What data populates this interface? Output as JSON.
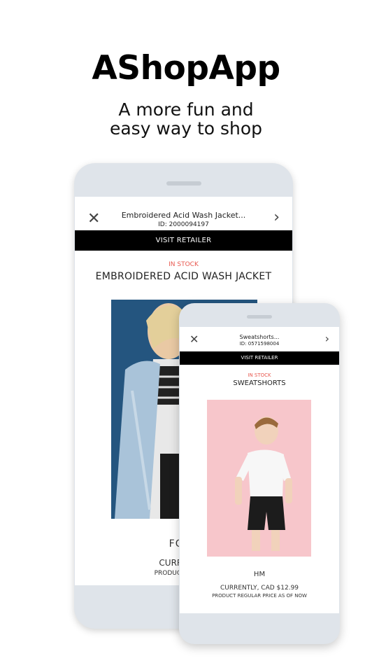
{
  "hero": {
    "title": "AShopApp",
    "subtitle_line1": "A more fun and",
    "subtitle_line2": "easy way to shop"
  },
  "back_screen": {
    "nav": {
      "title": "Embroidered Acid Wash Jacket...",
      "id": "ID: 2000094197",
      "close_icon": "close-icon",
      "next_icon": "chevron-right-icon"
    },
    "visit_label": "VISIT RETAILER",
    "stock": "IN STOCK",
    "product_name": "EMBROIDERED ACID WASH JACKET",
    "brand": "FORE",
    "price": "CURRENTLY",
    "note": "PRODUCT REGULA"
  },
  "front_screen": {
    "nav": {
      "title": "Sweatshorts...",
      "id": "ID: 0571598004",
      "close_icon": "close-icon",
      "next_icon": "chevron-right-icon"
    },
    "visit_label": "VISIT RETAILER",
    "stock": "IN STOCK",
    "product_name": "SWEATSHORTS",
    "brand": "HM",
    "price": "CURRENTLY, CAD $12.99",
    "note": "PRODUCT REGULAR PRICE AS OF NOW"
  },
  "colors": {
    "stock_accent": "#e8584f",
    "phone_frame": "#dfe4ea",
    "visit_bar": "#000000"
  }
}
